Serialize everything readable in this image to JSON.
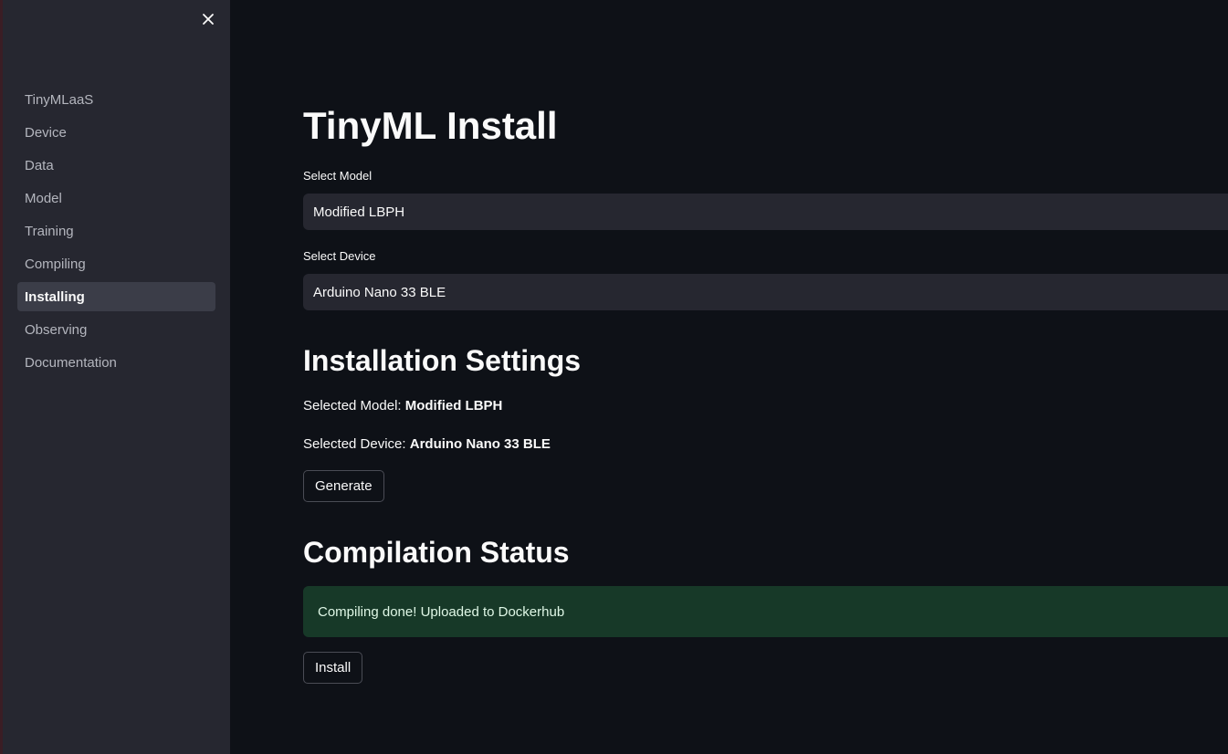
{
  "sidebar": {
    "items": [
      {
        "label": "TinyMLaaS"
      },
      {
        "label": "Device"
      },
      {
        "label": "Data"
      },
      {
        "label": "Model"
      },
      {
        "label": "Training"
      },
      {
        "label": "Compiling"
      },
      {
        "label": "Installing",
        "active": true
      },
      {
        "label": "Observing"
      },
      {
        "label": "Documentation"
      }
    ]
  },
  "main": {
    "title": "TinyML Install",
    "model_select": {
      "label": "Select Model",
      "value": "Modified LBPH"
    },
    "device_select": {
      "label": "Select Device",
      "value": "Arduino Nano 33 BLE"
    },
    "settings": {
      "heading": "Installation Settings",
      "model_prefix": "Selected Model: ",
      "model_value": "Modified LBPH",
      "device_prefix": "Selected Device: ",
      "device_value": "Arduino Nano 33 BLE",
      "generate_label": "Generate"
    },
    "status": {
      "heading": "Compilation Status",
      "message": "Compiling done! Uploaded to Dockerhub",
      "install_label": "Install"
    }
  },
  "colors": {
    "background": "#0e1117",
    "sidebar": "#262730",
    "success_bg": "#173928"
  }
}
